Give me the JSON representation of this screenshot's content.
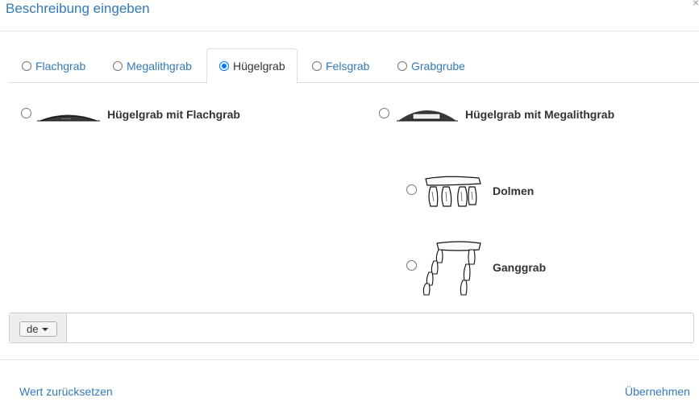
{
  "dialog": {
    "title": "Beschreibung eingeben",
    "close_glyph": "×"
  },
  "tabs": [
    {
      "label": "Flachgrab",
      "selected": false
    },
    {
      "label": "Megalithgrab",
      "selected": false
    },
    {
      "label": "Hügelgrab",
      "selected": true
    },
    {
      "label": "Felsgrab",
      "selected": false
    },
    {
      "label": "Grabgrube",
      "selected": false
    }
  ],
  "options": {
    "huegelgrab_flachgrab": {
      "label": "Hügelgrab mit Flachgrab",
      "selected": false,
      "icon": "mound-flat-grave-illustration"
    },
    "huegelgrab_megalithgrab": {
      "label": "Hügelgrab mit Megalithgrab",
      "selected": false,
      "icon": "mound-megalith-illustration"
    },
    "dolmen": {
      "label": "Dolmen",
      "selected": false,
      "icon": "dolmen-illustration"
    },
    "ganggrab": {
      "label": "Ganggrab",
      "selected": false,
      "icon": "passage-grave-illustration"
    }
  },
  "language_input": {
    "language": "de",
    "value": "",
    "placeholder": ""
  },
  "footer": {
    "reset_label": "Wert zurücksetzen",
    "apply_label": "Übernehmen"
  },
  "colors": {
    "link": "#337ab7",
    "border": "#dddddd",
    "radio_checked": "#0075ff"
  }
}
